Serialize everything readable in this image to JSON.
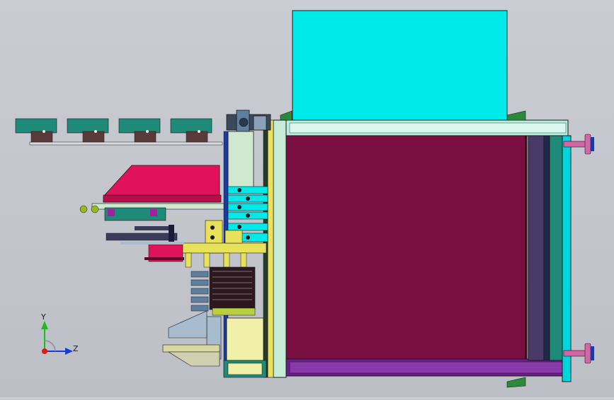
{
  "viewport": {
    "background": "#c4c7cd"
  },
  "colors": {
    "cyan": "#00eaea",
    "maroon": "#7a0f42",
    "magenta": "#e0135a",
    "teal": "#1f8a78",
    "yellow": "#e8e15a",
    "purple": "#6a1f8a",
    "blue": "#1a3aa0",
    "paleMint": "#c6ecd6",
    "green": "#2b8a3a",
    "pink": "#d466a8"
  },
  "triad": {
    "x_label": "Z",
    "y_label": "Y",
    "x_icon": "z-axis-arrow-icon",
    "y_icon": "y-axis-arrow-icon",
    "origin_icon": "origin-dot-icon"
  }
}
